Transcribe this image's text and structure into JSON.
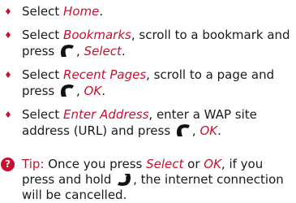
{
  "items": [
    {
      "pre": "Select ",
      "link": "Home",
      "post": "."
    },
    {
      "pre": "Select ",
      "link": "Bookmarks",
      "mid": ", scroll to a bookmark and press ",
      "after_key": ", ",
      "action": "Select",
      "end": "."
    },
    {
      "pre": "Select ",
      "link": "Recent Pages",
      "mid": ", scroll to a page and press ",
      "after_key": ", ",
      "action": "OK",
      "end": "."
    },
    {
      "pre": "Select ",
      "link": "Enter Address",
      "mid": ", enter a WAP site address (URL) and press ",
      "after_key": ", ",
      "action": "OK",
      "end": "."
    }
  ],
  "tip": {
    "icon_glyph": "?",
    "label": "Tip:",
    "t1": " Once you press ",
    "e1": "Select",
    "t2": " or ",
    "e2": "OK",
    "t3": ", if you press and hold ",
    "t4": ", the internet connection will be cancelled."
  },
  "icons": [
    "softkey-icon",
    "end-call-key-icon"
  ],
  "colors": {
    "accent": "#c8102e",
    "text": "#1a1a1a"
  }
}
